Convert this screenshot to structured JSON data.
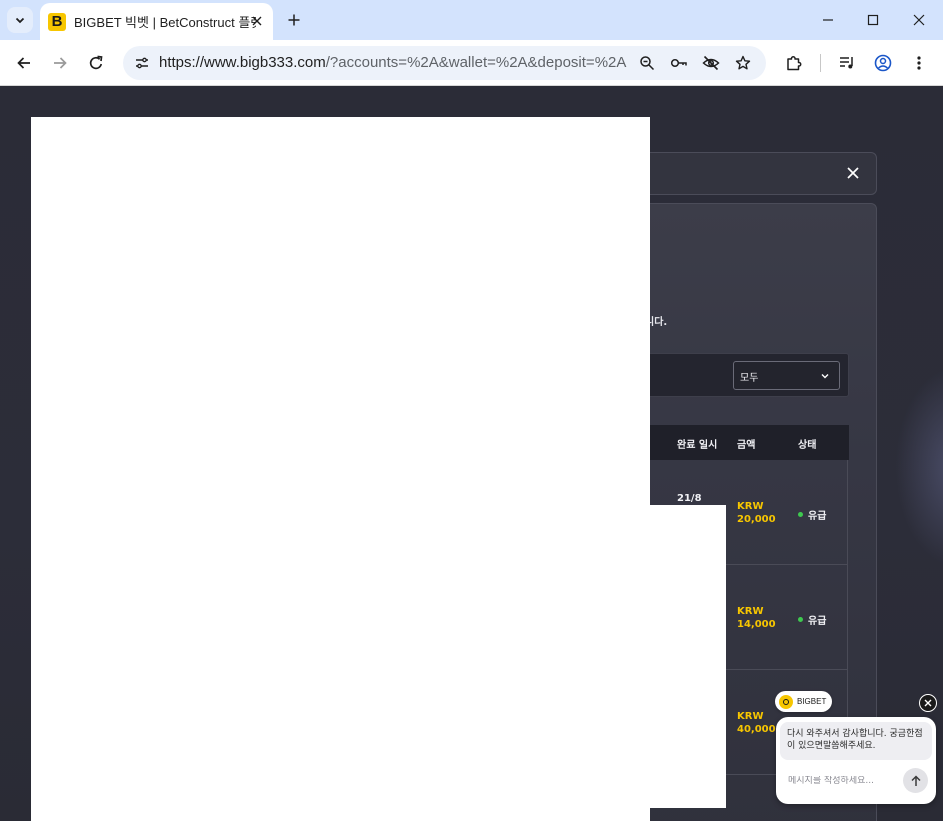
{
  "browser": {
    "tab_title": "BIGBET 빅벳 | BetConstruct 플랫폼",
    "favicon_letter": "B",
    "url_main": "https://www.bigb333.com",
    "url_query": "/?accounts=%2A&wallet=%2A&deposit=%2A",
    "icons": {
      "tab_search": "chevron-down-icon",
      "tab_close": "close-icon",
      "new_tab": "plus-icon",
      "minimize": "minimize-icon",
      "maximize": "maximize-icon",
      "close_window": "close-icon",
      "back": "arrow-left-icon",
      "forward": "arrow-right-icon",
      "reload": "reload-icon",
      "site_info": "tune-icon",
      "zoom": "zoom-icon",
      "password": "key-icon",
      "tracking": "eye-off-icon",
      "bookmark": "star-icon",
      "extensions": "puzzle-icon",
      "media": "media-control-icon",
      "profile": "profile-icon",
      "menu": "kebab-menu-icon"
    }
  },
  "page": {
    "info_text_fragment": "니다.",
    "filter": {
      "selected": "모두"
    },
    "table": {
      "headers": [
        "완료 일시",
        "금액",
        "상태"
      ],
      "rows": [
        {
          "date": "21/8",
          "amount_currency": "KRW",
          "amount_value": "20,000",
          "status": "유급"
        },
        {
          "date": "",
          "amount_currency": "KRW",
          "amount_value": "14,000",
          "status": "유급"
        },
        {
          "date": "",
          "amount_currency": "KRW",
          "amount_value": "40,000",
          "status": ""
        }
      ]
    }
  },
  "chat": {
    "brand": "BIGBET",
    "message": "다시 와주셔서 감사합니다. 궁금한점이 있으면말씀해주세요.",
    "input_placeholder": "메시지를 작성하세요...",
    "icons": {
      "close": "close-icon",
      "send": "arrow-up-icon",
      "logo": "brand-logo-icon"
    }
  },
  "colors": {
    "accent_yellow": "#f7c600",
    "status_green": "#3ec94f",
    "page_bg": "#2a2b35"
  }
}
